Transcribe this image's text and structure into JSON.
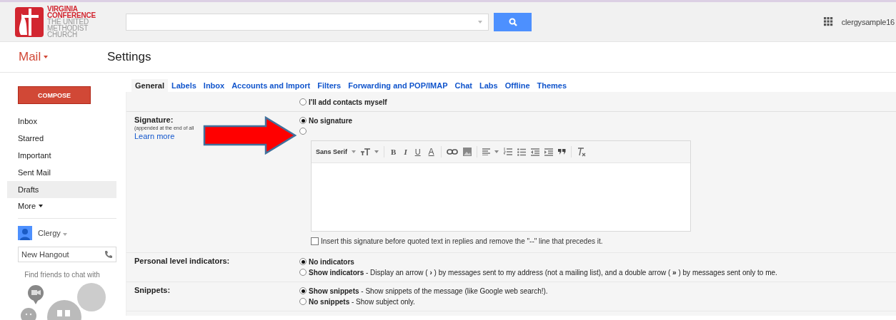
{
  "header": {
    "logo_lines": [
      "VIRGINIA",
      "CONFERENCE",
      "THE UNITED",
      "METHODIST",
      "CHURCH"
    ],
    "user": "clergysample16"
  },
  "app_menu": "Mail",
  "page_title": "Settings",
  "sidebar": {
    "compose": "COMPOSE",
    "items": [
      {
        "label": "Inbox",
        "selected": false
      },
      {
        "label": "Starred",
        "selected": false
      },
      {
        "label": "Important",
        "selected": false
      },
      {
        "label": "Sent Mail",
        "selected": false
      },
      {
        "label": "Drafts",
        "selected": true
      }
    ],
    "more": "More",
    "hangouts": {
      "user": "Clergy",
      "placeholder": "New Hangout",
      "hint": "Find friends to chat with"
    }
  },
  "tabs": [
    {
      "label": "General",
      "selected": true
    },
    {
      "label": "Labels",
      "selected": false
    },
    {
      "label": "Inbox",
      "selected": false
    },
    {
      "label": "Accounts and Import",
      "selected": false
    },
    {
      "label": "Filters",
      "selected": false
    },
    {
      "label": "Forwarding and POP/IMAP",
      "selected": false
    },
    {
      "label": "Chat",
      "selected": false
    },
    {
      "label": "Labs",
      "selected": false
    },
    {
      "label": "Offline",
      "selected": false
    },
    {
      "label": "Themes",
      "selected": false
    }
  ],
  "settings": [
    {
      "options": [
        {
          "text": "**I'll add contacts myself**",
          "selected": false
        }
      ]
    },
    {
      "label": "Signature:",
      "sublabel": "(appended at the end of all",
      "link": "Learn more",
      "options": [
        {
          "text": "**No signature**",
          "selected": true
        },
        {
          "selected": false
        }
      ],
      "editor": {
        "toolbar": [
          {
            "kind": "font",
            "label": "Sans Serif"
          },
          {
            "kind": "size"
          },
          {
            "kind": "sep"
          },
          {
            "kind": "bold",
            "label": "B"
          },
          {
            "kind": "italic",
            "label": "I"
          },
          {
            "kind": "underline",
            "label": "U"
          },
          {
            "kind": "color",
            "label": "A"
          },
          {
            "kind": "sep"
          },
          {
            "kind": "link"
          },
          {
            "kind": "image"
          },
          {
            "kind": "sep"
          },
          {
            "kind": "align"
          },
          {
            "kind": "numbered"
          },
          {
            "kind": "bulleted"
          },
          {
            "kind": "outdent"
          },
          {
            "kind": "indent"
          },
          {
            "kind": "quote"
          },
          {
            "kind": "sep"
          },
          {
            "kind": "clear"
          }
        ]
      },
      "checkbox": {
        "text": "Insert this signature before quoted text in replies and remove the \"--\" line that precedes it.",
        "checked": false
      }
    },
    {
      "label": "Personal level indicators:",
      "options": [
        {
          "text": "**No indicators**",
          "selected": true
        },
        {
          "text": "**Show indicators** - Display an arrow ( **›** ) by messages sent to my address (not a mailing list), and a double arrow ( **»** ) by messages sent only to me.",
          "selected": false
        }
      ]
    },
    {
      "label": "Snippets:",
      "options": [
        {
          "text": "**Show snippets** - Show snippets of the message (like Google web search!).",
          "selected": true
        },
        {
          "text": "**No snippets** - Show subject only.",
          "selected": false
        }
      ]
    }
  ],
  "annotation": {
    "kind": "arrow"
  }
}
